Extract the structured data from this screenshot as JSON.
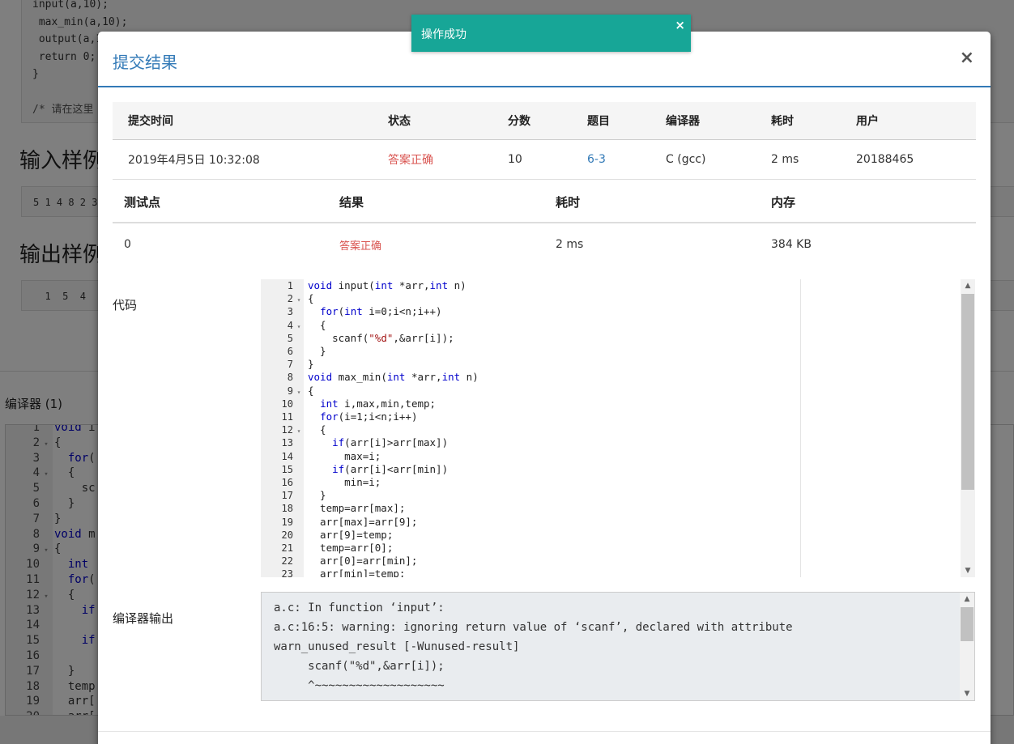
{
  "toast": {
    "text": "操作成功",
    "close": "×"
  },
  "modal": {
    "title": "提交结果",
    "close": "×"
  },
  "summary": {
    "headers": [
      "提交时间",
      "状态",
      "分数",
      "题目",
      "编译器",
      "耗时",
      "用户"
    ],
    "row": {
      "time": "2019年4月5日 10:32:08",
      "status": "答案正确",
      "score": "10",
      "problem": "6-3",
      "compiler": "C (gcc)",
      "duration": "2 ms",
      "user": "20188465"
    }
  },
  "testpoints": {
    "headers": [
      "测试点",
      "结果",
      "耗时",
      "内存"
    ],
    "row": {
      "id": "0",
      "result": "答案正确",
      "duration": "2 ms",
      "memory": "384 KB"
    }
  },
  "code_section": {
    "label": "代码",
    "lines": [
      {
        "n": "1",
        "fold": "",
        "t": "void input(int *arr,int n)"
      },
      {
        "n": "2",
        "fold": "▾",
        "t": "{"
      },
      {
        "n": "3",
        "fold": "",
        "t": "  for(int i=0;i<n;i++)"
      },
      {
        "n": "4",
        "fold": "▾",
        "t": "  {"
      },
      {
        "n": "5",
        "fold": "",
        "t": "    scanf(\"%d\",&arr[i]);"
      },
      {
        "n": "6",
        "fold": "",
        "t": "  }"
      },
      {
        "n": "7",
        "fold": "",
        "t": "}"
      },
      {
        "n": "8",
        "fold": "",
        "t": "void max_min(int *arr,int n)"
      },
      {
        "n": "9",
        "fold": "▾",
        "t": "{"
      },
      {
        "n": "10",
        "fold": "",
        "t": "  int i,max,min,temp;"
      },
      {
        "n": "11",
        "fold": "",
        "t": "  for(i=1;i<n;i++)"
      },
      {
        "n": "12",
        "fold": "▾",
        "t": "  {"
      },
      {
        "n": "13",
        "fold": "",
        "t": "    if(arr[i]>arr[max])"
      },
      {
        "n": "14",
        "fold": "",
        "t": "      max=i;"
      },
      {
        "n": "15",
        "fold": "",
        "t": "    if(arr[i]<arr[min])"
      },
      {
        "n": "16",
        "fold": "",
        "t": "      min=i;"
      },
      {
        "n": "17",
        "fold": "",
        "t": "  }"
      },
      {
        "n": "18",
        "fold": "",
        "t": "  temp=arr[max];"
      },
      {
        "n": "19",
        "fold": "",
        "t": "  arr[max]=arr[9];"
      },
      {
        "n": "20",
        "fold": "",
        "t": "  arr[9]=temp;"
      },
      {
        "n": "21",
        "fold": "",
        "t": "  temp=arr[0];"
      },
      {
        "n": "22",
        "fold": "",
        "t": "  arr[0]=arr[min];"
      },
      {
        "n": "23",
        "fold": "",
        "t": "  arr[min]=temp;"
      }
    ]
  },
  "compiler_output": {
    "label": "编译器输出",
    "lines": [
      "a.c: In function ‘input’:",
      "a.c:16:5: warning: ignoring return value of ‘scanf’, declared with attribute",
      "warn_unused_result [-Wunused-result]",
      "     scanf(\"%d\",&arr[i]);",
      "     ^~~~~~~~~~~~~~~~~~~~"
    ]
  },
  "background": {
    "top_code": [
      "input(a,10);",
      " max_min(a,10);",
      " output(a,1",
      " return 0;",
      "}"
    ],
    "comment": "/* 请在这里",
    "input_sample_title": "输入样例",
    "input_sample": "5 1 4 8 2 3",
    "output_sample_title": "输出样例",
    "output_sample": "  1  5  4",
    "compiler_label": "编译器 (1)",
    "editor_lines": [
      {
        "n": "1",
        "fold": "",
        "t": "void i"
      },
      {
        "n": "2",
        "fold": "▾",
        "t": "{"
      },
      {
        "n": "3",
        "fold": "",
        "t": "  for("
      },
      {
        "n": "4",
        "fold": "▾",
        "t": "  {"
      },
      {
        "n": "5",
        "fold": "",
        "t": "    sc"
      },
      {
        "n": "6",
        "fold": "",
        "t": "  }"
      },
      {
        "n": "7",
        "fold": "",
        "t": "}"
      },
      {
        "n": "8",
        "fold": "",
        "t": "void m"
      },
      {
        "n": "9",
        "fold": "▾",
        "t": "{"
      },
      {
        "n": "10",
        "fold": "",
        "t": "  int"
      },
      {
        "n": "11",
        "fold": "",
        "t": "  for("
      },
      {
        "n": "12",
        "fold": "▾",
        "t": "  {"
      },
      {
        "n": "13",
        "fold": "",
        "t": "    if"
      },
      {
        "n": "14",
        "fold": "",
        "t": ""
      },
      {
        "n": "15",
        "fold": "",
        "t": "    if"
      },
      {
        "n": "16",
        "fold": "",
        "t": ""
      },
      {
        "n": "17",
        "fold": "",
        "t": "  }"
      },
      {
        "n": "18",
        "fold": "",
        "t": "  temp"
      },
      {
        "n": "19",
        "fold": "",
        "t": "  arr["
      },
      {
        "n": "20",
        "fold": "",
        "t": "  arr["
      }
    ]
  },
  "colors": {
    "accent": "#337ab7",
    "success_toast": "#17a697",
    "status_ok": "#d9534f"
  }
}
